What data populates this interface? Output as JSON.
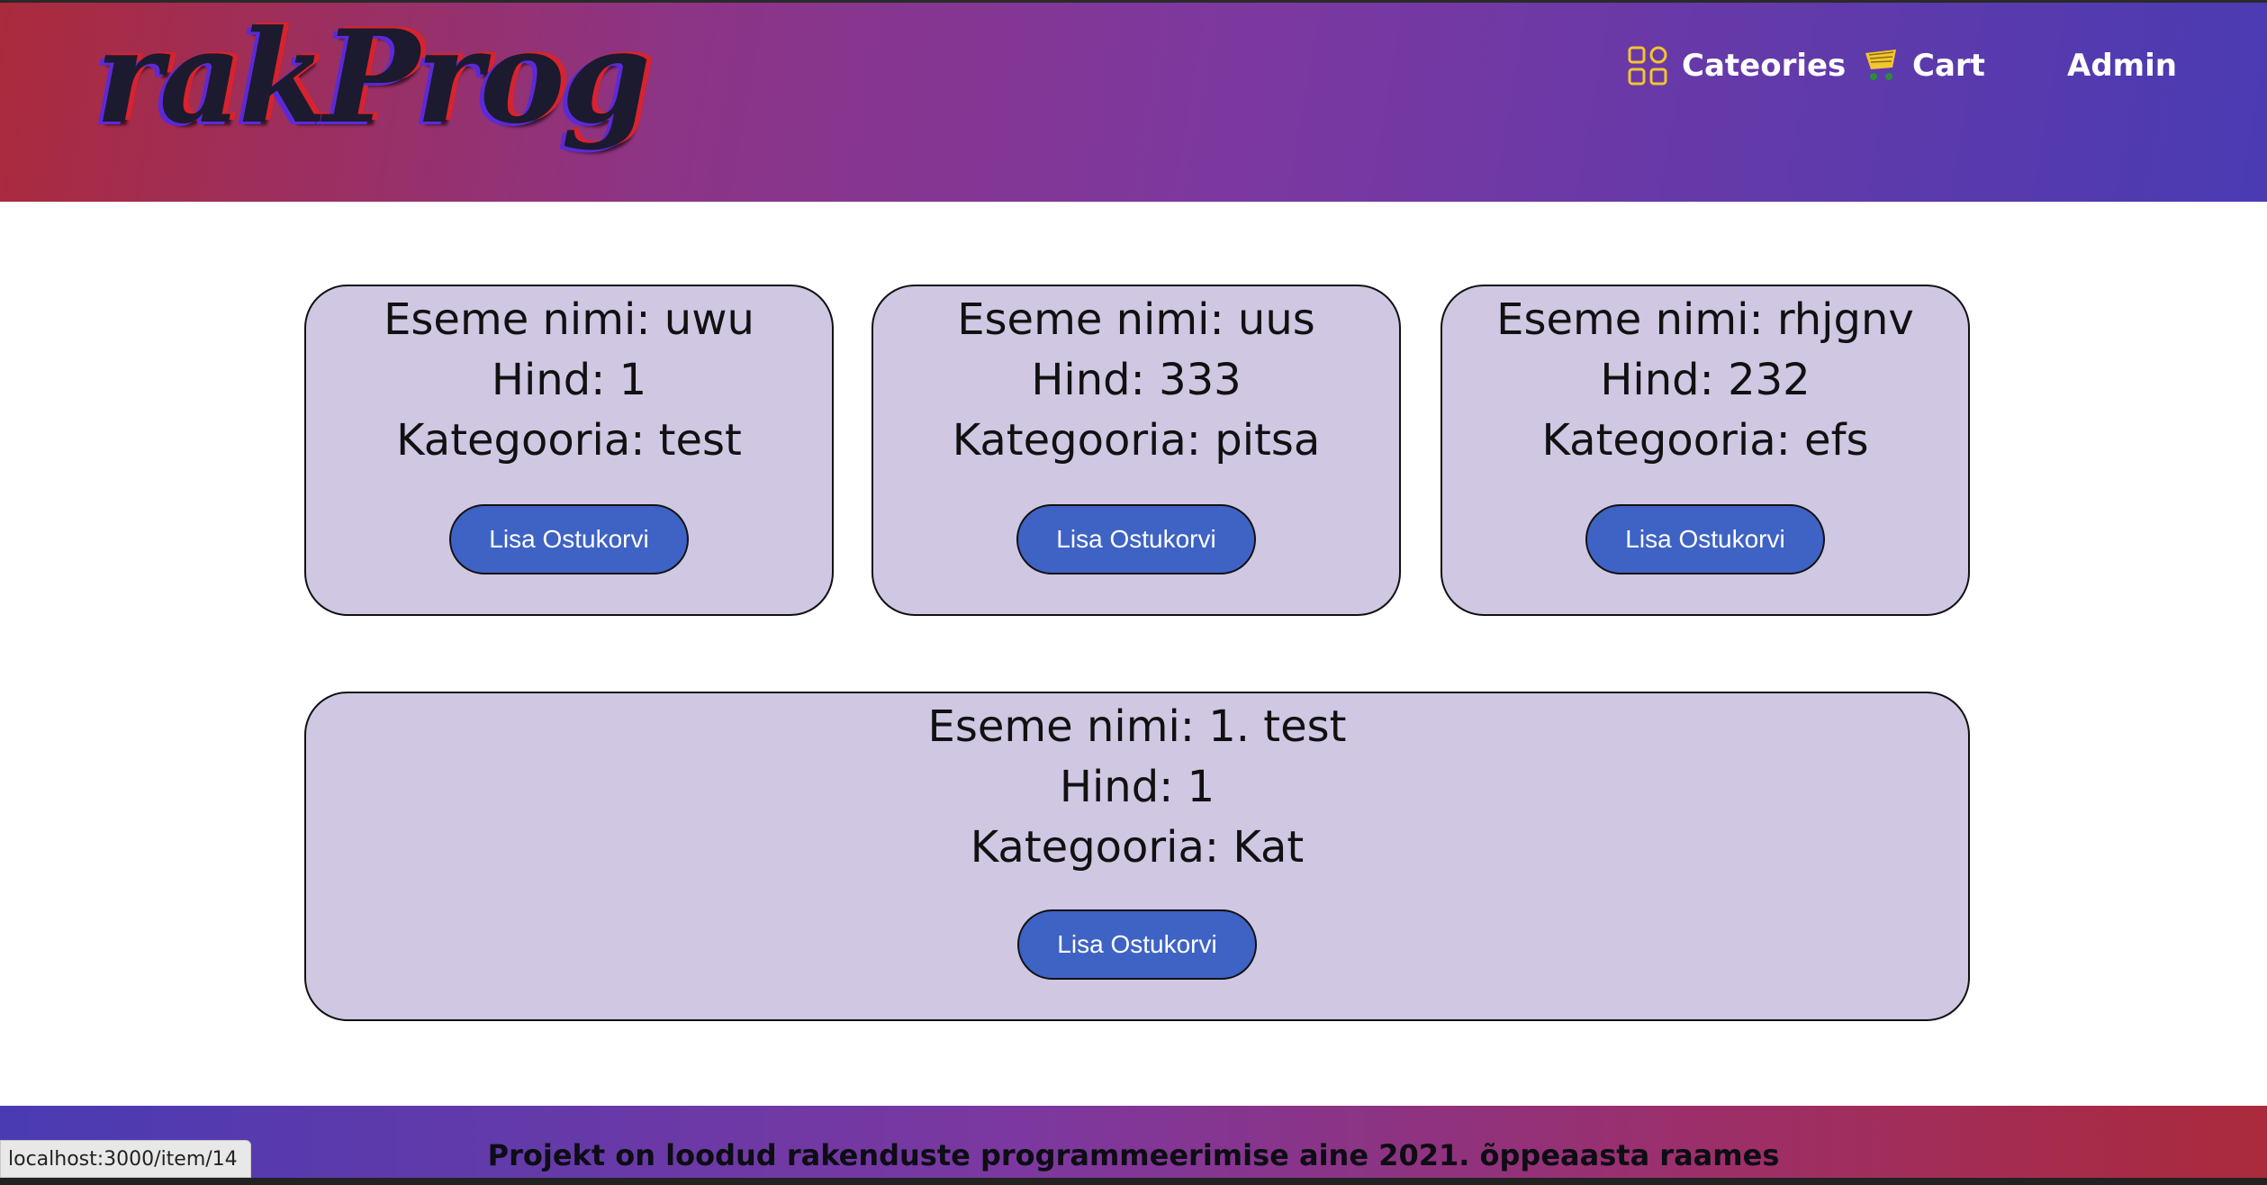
{
  "header": {
    "logo_text": "rakProg",
    "nav": {
      "categories_label": "Cateories",
      "cart_label": "Cart",
      "admin_label": "Admin"
    }
  },
  "items": [
    {
      "name_line": "Eseme nimi: uwu",
      "price_line": "Hind: 1",
      "category_line": "Kategooria: test",
      "button_label": "Lisa Ostukorvi"
    },
    {
      "name_line": "Eseme nimi: uus",
      "price_line": "Hind: 333",
      "category_line": "Kategooria: pitsa",
      "button_label": "Lisa Ostukorvi"
    },
    {
      "name_line": "Eseme nimi: rhjgnv",
      "price_line": "Hind: 232",
      "category_line": "Kategooria: efs",
      "button_label": "Lisa Ostukorvi"
    },
    {
      "name_line": "Eseme nimi: 1. test",
      "price_line": "Hind: 1",
      "category_line": "Kategooria: Kat",
      "button_label": "Lisa Ostukorvi"
    }
  ],
  "footer": {
    "text": "Projekt on loodud rakenduste programmeerimise aine 2021. õppeaasta raames"
  },
  "status_bar": {
    "url": "localhost:3000/item/14"
  },
  "colors": {
    "card_bg": "#d0c7e3",
    "button_bg": "#3e63c4",
    "header_gradient_start": "#ab2a3c",
    "header_gradient_end": "#4a3bb3"
  },
  "icons": {
    "categories": "grid-icon",
    "cart": "cart-icon"
  }
}
